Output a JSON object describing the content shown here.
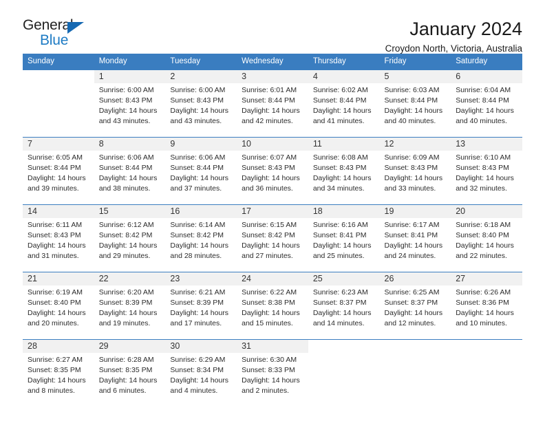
{
  "brand": {
    "name_part1": "General",
    "name_part2": "Blue",
    "accent_color": "#1e7bc4",
    "triangle_icon": "triangle-icon"
  },
  "header": {
    "title": "January 2024",
    "subtitle": "Croydon North, Victoria, Australia"
  },
  "calendar": {
    "header_bg": "#3a7dc0",
    "weekdays": [
      "Sunday",
      "Monday",
      "Tuesday",
      "Wednesday",
      "Thursday",
      "Friday",
      "Saturday"
    ],
    "weeks": [
      [
        {
          "day": "",
          "sunrise": "",
          "sunset": "",
          "daylight_line1": "",
          "daylight_line2": "",
          "empty": true
        },
        {
          "day": "1",
          "sunrise": "Sunrise: 6:00 AM",
          "sunset": "Sunset: 8:43 PM",
          "daylight_line1": "Daylight: 14 hours",
          "daylight_line2": "and 43 minutes."
        },
        {
          "day": "2",
          "sunrise": "Sunrise: 6:00 AM",
          "sunset": "Sunset: 8:43 PM",
          "daylight_line1": "Daylight: 14 hours",
          "daylight_line2": "and 43 minutes."
        },
        {
          "day": "3",
          "sunrise": "Sunrise: 6:01 AM",
          "sunset": "Sunset: 8:44 PM",
          "daylight_line1": "Daylight: 14 hours",
          "daylight_line2": "and 42 minutes."
        },
        {
          "day": "4",
          "sunrise": "Sunrise: 6:02 AM",
          "sunset": "Sunset: 8:44 PM",
          "daylight_line1": "Daylight: 14 hours",
          "daylight_line2": "and 41 minutes."
        },
        {
          "day": "5",
          "sunrise": "Sunrise: 6:03 AM",
          "sunset": "Sunset: 8:44 PM",
          "daylight_line1": "Daylight: 14 hours",
          "daylight_line2": "and 40 minutes."
        },
        {
          "day": "6",
          "sunrise": "Sunrise: 6:04 AM",
          "sunset": "Sunset: 8:44 PM",
          "daylight_line1": "Daylight: 14 hours",
          "daylight_line2": "and 40 minutes."
        }
      ],
      [
        {
          "day": "7",
          "sunrise": "Sunrise: 6:05 AM",
          "sunset": "Sunset: 8:44 PM",
          "daylight_line1": "Daylight: 14 hours",
          "daylight_line2": "and 39 minutes."
        },
        {
          "day": "8",
          "sunrise": "Sunrise: 6:06 AM",
          "sunset": "Sunset: 8:44 PM",
          "daylight_line1": "Daylight: 14 hours",
          "daylight_line2": "and 38 minutes."
        },
        {
          "day": "9",
          "sunrise": "Sunrise: 6:06 AM",
          "sunset": "Sunset: 8:44 PM",
          "daylight_line1": "Daylight: 14 hours",
          "daylight_line2": "and 37 minutes."
        },
        {
          "day": "10",
          "sunrise": "Sunrise: 6:07 AM",
          "sunset": "Sunset: 8:43 PM",
          "daylight_line1": "Daylight: 14 hours",
          "daylight_line2": "and 36 minutes."
        },
        {
          "day": "11",
          "sunrise": "Sunrise: 6:08 AM",
          "sunset": "Sunset: 8:43 PM",
          "daylight_line1": "Daylight: 14 hours",
          "daylight_line2": "and 34 minutes."
        },
        {
          "day": "12",
          "sunrise": "Sunrise: 6:09 AM",
          "sunset": "Sunset: 8:43 PM",
          "daylight_line1": "Daylight: 14 hours",
          "daylight_line2": "and 33 minutes."
        },
        {
          "day": "13",
          "sunrise": "Sunrise: 6:10 AM",
          "sunset": "Sunset: 8:43 PM",
          "daylight_line1": "Daylight: 14 hours",
          "daylight_line2": "and 32 minutes."
        }
      ],
      [
        {
          "day": "14",
          "sunrise": "Sunrise: 6:11 AM",
          "sunset": "Sunset: 8:43 PM",
          "daylight_line1": "Daylight: 14 hours",
          "daylight_line2": "and 31 minutes."
        },
        {
          "day": "15",
          "sunrise": "Sunrise: 6:12 AM",
          "sunset": "Sunset: 8:42 PM",
          "daylight_line1": "Daylight: 14 hours",
          "daylight_line2": "and 29 minutes."
        },
        {
          "day": "16",
          "sunrise": "Sunrise: 6:14 AM",
          "sunset": "Sunset: 8:42 PM",
          "daylight_line1": "Daylight: 14 hours",
          "daylight_line2": "and 28 minutes."
        },
        {
          "day": "17",
          "sunrise": "Sunrise: 6:15 AM",
          "sunset": "Sunset: 8:42 PM",
          "daylight_line1": "Daylight: 14 hours",
          "daylight_line2": "and 27 minutes."
        },
        {
          "day": "18",
          "sunrise": "Sunrise: 6:16 AM",
          "sunset": "Sunset: 8:41 PM",
          "daylight_line1": "Daylight: 14 hours",
          "daylight_line2": "and 25 minutes."
        },
        {
          "day": "19",
          "sunrise": "Sunrise: 6:17 AM",
          "sunset": "Sunset: 8:41 PM",
          "daylight_line1": "Daylight: 14 hours",
          "daylight_line2": "and 24 minutes."
        },
        {
          "day": "20",
          "sunrise": "Sunrise: 6:18 AM",
          "sunset": "Sunset: 8:40 PM",
          "daylight_line1": "Daylight: 14 hours",
          "daylight_line2": "and 22 minutes."
        }
      ],
      [
        {
          "day": "21",
          "sunrise": "Sunrise: 6:19 AM",
          "sunset": "Sunset: 8:40 PM",
          "daylight_line1": "Daylight: 14 hours",
          "daylight_line2": "and 20 minutes."
        },
        {
          "day": "22",
          "sunrise": "Sunrise: 6:20 AM",
          "sunset": "Sunset: 8:39 PM",
          "daylight_line1": "Daylight: 14 hours",
          "daylight_line2": "and 19 minutes."
        },
        {
          "day": "23",
          "sunrise": "Sunrise: 6:21 AM",
          "sunset": "Sunset: 8:39 PM",
          "daylight_line1": "Daylight: 14 hours",
          "daylight_line2": "and 17 minutes."
        },
        {
          "day": "24",
          "sunrise": "Sunrise: 6:22 AM",
          "sunset": "Sunset: 8:38 PM",
          "daylight_line1": "Daylight: 14 hours",
          "daylight_line2": "and 15 minutes."
        },
        {
          "day": "25",
          "sunrise": "Sunrise: 6:23 AM",
          "sunset": "Sunset: 8:37 PM",
          "daylight_line1": "Daylight: 14 hours",
          "daylight_line2": "and 14 minutes."
        },
        {
          "day": "26",
          "sunrise": "Sunrise: 6:25 AM",
          "sunset": "Sunset: 8:37 PM",
          "daylight_line1": "Daylight: 14 hours",
          "daylight_line2": "and 12 minutes."
        },
        {
          "day": "27",
          "sunrise": "Sunrise: 6:26 AM",
          "sunset": "Sunset: 8:36 PM",
          "daylight_line1": "Daylight: 14 hours",
          "daylight_line2": "and 10 minutes."
        }
      ],
      [
        {
          "day": "28",
          "sunrise": "Sunrise: 6:27 AM",
          "sunset": "Sunset: 8:35 PM",
          "daylight_line1": "Daylight: 14 hours",
          "daylight_line2": "and 8 minutes."
        },
        {
          "day": "29",
          "sunrise": "Sunrise: 6:28 AM",
          "sunset": "Sunset: 8:35 PM",
          "daylight_line1": "Daylight: 14 hours",
          "daylight_line2": "and 6 minutes."
        },
        {
          "day": "30",
          "sunrise": "Sunrise: 6:29 AM",
          "sunset": "Sunset: 8:34 PM",
          "daylight_line1": "Daylight: 14 hours",
          "daylight_line2": "and 4 minutes."
        },
        {
          "day": "31",
          "sunrise": "Sunrise: 6:30 AM",
          "sunset": "Sunset: 8:33 PM",
          "daylight_line1": "Daylight: 14 hours",
          "daylight_line2": "and 2 minutes."
        },
        {
          "day": "",
          "sunrise": "",
          "sunset": "",
          "daylight_line1": "",
          "daylight_line2": "",
          "empty": true
        },
        {
          "day": "",
          "sunrise": "",
          "sunset": "",
          "daylight_line1": "",
          "daylight_line2": "",
          "empty": true
        },
        {
          "day": "",
          "sunrise": "",
          "sunset": "",
          "daylight_line1": "",
          "daylight_line2": "",
          "empty": true
        }
      ]
    ]
  }
}
